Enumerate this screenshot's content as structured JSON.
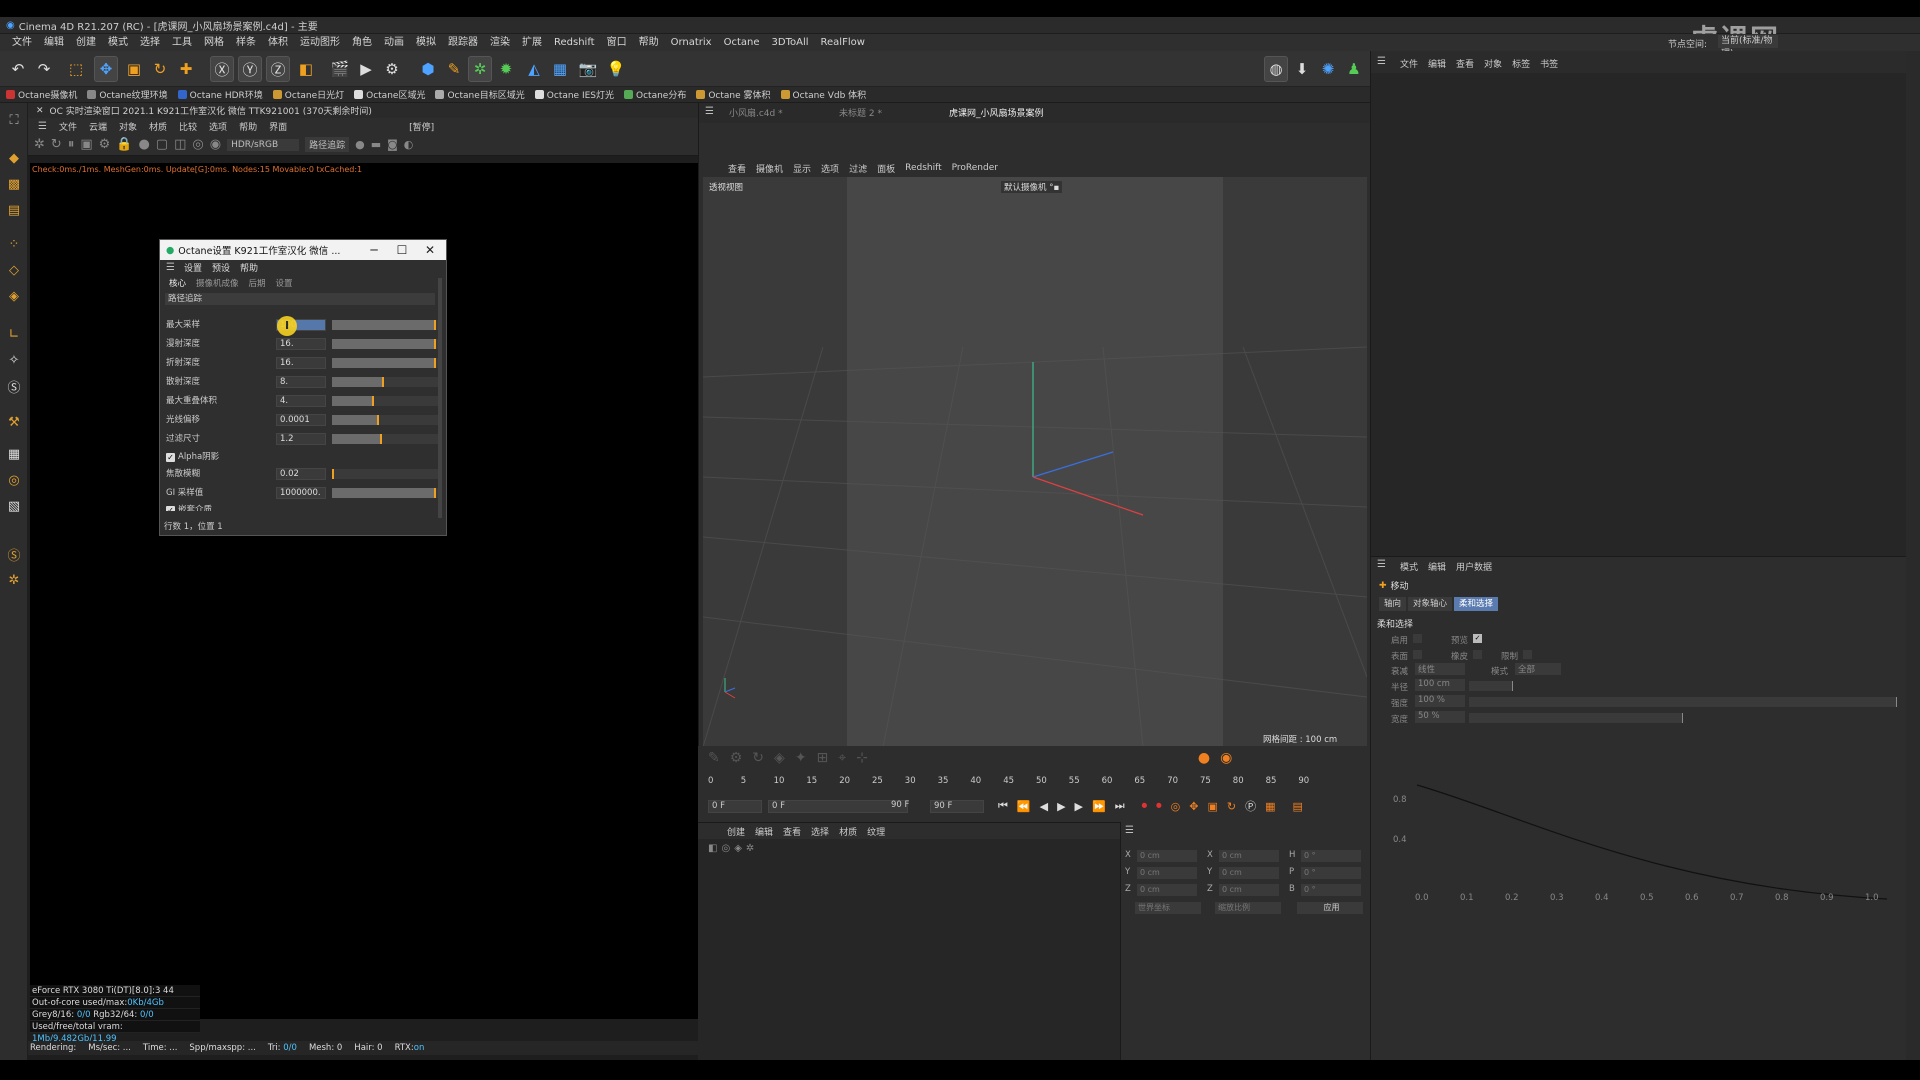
{
  "window": {
    "title": "Cinema 4D R21.207 (RC) - [虎课网_小风扇场景案例.c4d] - 主要"
  },
  "menubar": [
    "文件",
    "编辑",
    "创建",
    "模式",
    "选择",
    "工具",
    "网格",
    "样条",
    "体积",
    "运动图形",
    "角色",
    "动画",
    "模拟",
    "跟踪器",
    "渲染",
    "扩展",
    "Redshift",
    "窗口",
    "帮助",
    "Ornatrix",
    "Octane",
    "3DToAll",
    "RealFlow"
  ],
  "layout": {
    "label": "节点空间:",
    "value": "当前(标准/物理)",
    "watermark": "虎课网"
  },
  "plugin_bar": [
    "Octane摄像机",
    "Octane纹理环境",
    "Octane HDR环境",
    "Octane日光灯",
    "Octane区域光",
    "Octane目标区域光",
    "Octane IES灯光",
    "Octane分布",
    "Octane 雾体积",
    "Octane Vdb 体积"
  ],
  "octane_viewer": {
    "title": "OC 实时渲染窗口  2021.1  K921工作室汉化 微信 TTK921001 (370天剩余时间)",
    "menu": [
      "文件",
      "云端",
      "对象",
      "材质",
      "比较",
      "选项",
      "帮助",
      "界面"
    ],
    "paused_label": "[暂停]",
    "colorspace": "HDR/sRGB",
    "kernel": "路径追踪",
    "status_line": "Check:0ms./1ms. MeshGen:0ms. Update[G]:0ms. Nodes:15 Movable:0 txCached:1",
    "gpu_info": [
      {
        "text": "eForce RTX 3080 Ti(DT)[8.0]:3      44"
      },
      {
        "label": "Out-of-core used/max:",
        "value": "0Kb/4Gb"
      },
      {
        "label": "Grey8/16: ",
        "value": "0/0",
        "label2": "   Rgb32/64: ",
        "value2": "0/0"
      },
      {
        "label": "Used/free/total vram: ",
        "value": "1Mb/9.482Gb/11.99"
      }
    ],
    "bottom_status": {
      "rendering": "Rendering:",
      "ms": "Ms/sec: ...",
      "time": "Time: ...",
      "spp": "Spp/maxspp: ...",
      "tri_label": "Tri:",
      "tri": "0/0",
      "mesh": "Mesh: 0",
      "hair": "Hair: 0",
      "rtx_label": "RTX:",
      "rtx": "on"
    }
  },
  "octane_settings": {
    "title": "Octane设置  K921工作室汉化  微信 ...",
    "menu": [
      "设置",
      "预设",
      "帮助"
    ],
    "tabs": [
      "核心",
      "摄像机成像",
      "后期",
      "设置"
    ],
    "active_tab": 0,
    "section": "路径追踪",
    "params": [
      {
        "label": "最大采样",
        "value": "160",
        "fill": 1.0
      },
      {
        "label": "漫射深度",
        "value": "16.",
        "fill": 1.0
      },
      {
        "label": "折射深度",
        "value": "16.",
        "fill": 1.0
      },
      {
        "label": "散射深度",
        "value": "8.",
        "fill": 0.5
      },
      {
        "label": "最大重叠体积",
        "value": "4.",
        "fill": 0.4
      },
      {
        "label": "光线偏移",
        "value": "0.0001",
        "fill": 0.45
      },
      {
        "label": "过滤尺寸",
        "value": "1.2",
        "fill": 0.48
      }
    ],
    "alpha_shadow": {
      "label": "Alpha阴影",
      "checked": true
    },
    "params2": [
      {
        "label": "焦散模糊",
        "value": "0.02",
        "fill": 0.02
      },
      {
        "label": "GI 采样值",
        "value": "1000000.",
        "fill": 1.0
      }
    ],
    "partial_row": "嵌套介质",
    "status": "行数 1，位置 1"
  },
  "viewport": {
    "tabs": [
      "小风扇.c4d *",
      "未标题 2 *",
      "虎课网_小风扇场景案例"
    ],
    "active_tab": 2,
    "menu": [
      "查看",
      "摄像机",
      "显示",
      "选项",
      "过滤",
      "面板",
      "Redshift",
      "ProRender"
    ],
    "label": "透视视图",
    "camera": "默认摄像机 °▪",
    "grid": "网格间距 : 100 cm"
  },
  "timeline": {
    "ticks": [
      "0",
      "5",
      "10",
      "15",
      "20",
      "25",
      "30",
      "35",
      "40",
      "45",
      "50",
      "55",
      "60",
      "65",
      "70",
      "75",
      "80",
      "85",
      "90"
    ],
    "current_frame": "0 F",
    "start": "0 F",
    "range_start": "0 F",
    "range_end": "90 F",
    "end": "90 F"
  },
  "material_manager": {
    "menu": [
      "创建",
      "编辑",
      "查看",
      "选择",
      "材质",
      "纹理"
    ]
  },
  "coords": {
    "rows": [
      {
        "axis": "X",
        "pos": "0 cm",
        "size": "0 cm",
        "rot_label": "H",
        "rot": "0 °"
      },
      {
        "axis": "Y",
        "pos": "0 cm",
        "size": "0 cm",
        "rot_label": "P",
        "rot": "0 °"
      },
      {
        "axis": "Z",
        "pos": "0 cm",
        "size": "0 cm",
        "rot_label": "B",
        "rot": "0 °"
      }
    ],
    "world_label": "世界坐标",
    "scale_label": "缩放比例",
    "apply_button": "应用"
  },
  "object_manager": {
    "menu": [
      "文件",
      "编辑",
      "查看",
      "对象",
      "标签",
      "书签"
    ]
  },
  "attribute_manager": {
    "menu": [
      "模式",
      "编辑",
      "用户数据"
    ],
    "header": "移动",
    "tabs": [
      "轴向",
      "对象轴心",
      "柔和选择"
    ],
    "active_tab": 2,
    "section": "柔和选择",
    "rows": [
      {
        "a": "启用",
        "b": "预览"
      },
      {
        "a": "表面",
        "b": "橡皮",
        "c": "限制"
      }
    ],
    "mode_label": "衰减",
    "mode_value": "线性",
    "mode2_label": "模式",
    "mode2_value": "全部",
    "radius": {
      "label": "半径",
      "value": "100 cm"
    },
    "strength": {
      "label": "强度",
      "value": "100 %"
    },
    "width": {
      "label": "宽度",
      "value": "50 %"
    },
    "curve_y_labels": [
      "0.8",
      "0.4"
    ],
    "curve_x_labels": [
      "0.0",
      "0.1",
      "0.2",
      "0.3",
      "0.4",
      "0.5",
      "0.6",
      "0.7",
      "0.8",
      "0.9",
      "1.0"
    ]
  }
}
